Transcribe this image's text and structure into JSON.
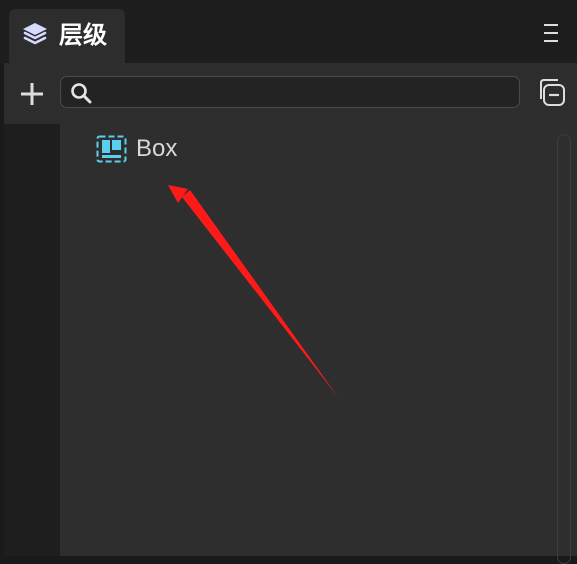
{
  "panel": {
    "tab_label": "层级",
    "tab_icon": "layers-icon",
    "menu_icon": "hamburger-menu-icon"
  },
  "toolbar": {
    "add_icon": "plus-icon",
    "search_icon": "search-icon",
    "search_value": "",
    "search_placeholder": "",
    "collapse_icon": "collapse-all-icon"
  },
  "tree": {
    "nodes": [
      {
        "label": "Box",
        "icon": "box-node-icon"
      }
    ]
  },
  "colors": {
    "tab_bg": "#2d2d2d",
    "panel_bg": "#2e2e2e",
    "node_icon": "#5ad0f0",
    "annotation_arrow": "#ff1a1a"
  }
}
